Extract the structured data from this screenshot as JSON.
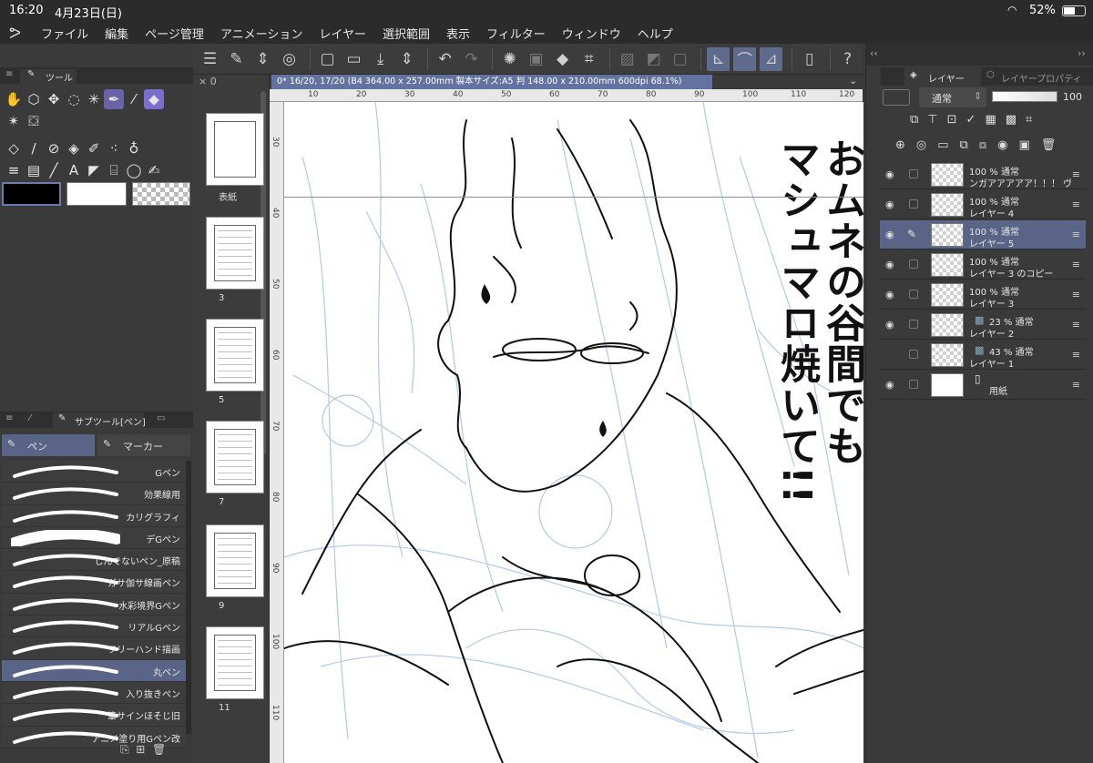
{
  "status": {
    "time": "16:20",
    "date": "4月23日(日)",
    "battery": "52%"
  },
  "menu": [
    "ファイル",
    "編集",
    "ページ管理",
    "アニメーション",
    "レイヤー",
    "選択範囲",
    "表示",
    "フィルター",
    "ウィンドウ",
    "ヘルプ"
  ],
  "tool_panel": {
    "title": "ツール"
  },
  "subtool_panel": {
    "title": "サブツール[ペン]",
    "tabs": [
      "ペン",
      "マーカー"
    ],
    "items": [
      "Gペン",
      "効果線用",
      "カリグラフィ",
      "デGペン",
      "しんでないペン_原稿",
      "ガサ伽サ線画ペン",
      "水彩境界Gペン",
      "リアルGペン",
      "フリーハンド描画",
      "丸ペン",
      "入り抜きペン",
      "筆サインほそじ旧",
      "アニメ塗り用Gペン改"
    ],
    "selected_index": 9
  },
  "pages": {
    "zoom_label": "× 0",
    "items": [
      {
        "label": "表紙"
      },
      {
        "label": "3"
      },
      {
        "label": "5"
      },
      {
        "label": "7"
      },
      {
        "label": "9"
      },
      {
        "label": "11"
      }
    ]
  },
  "canvas": {
    "tab_title": "0* 16/20, 17/20 (B4 364.00 x 257.00mm 製本サイズ:A5 判 148.00 x 210.00mm 600dpi 68.1%)",
    "ruler_top": [
      "10",
      "20",
      "30",
      "40",
      "50",
      "60",
      "70",
      "80",
      "90",
      "100",
      "110",
      "120"
    ],
    "ruler_left": [
      "30",
      "40",
      "50",
      "60",
      "70",
      "80",
      "90",
      "100",
      "110"
    ],
    "manga_text_col1": "おムネの谷間でも",
    "manga_text_col2": "マシュマロ焼いて!!"
  },
  "layers_panel": {
    "tabs": [
      "レイヤー",
      "レイヤープロパティ"
    ],
    "blend_mode": "通常",
    "opacity": "100",
    "layers": [
      {
        "line1": "100 % 通常",
        "line2": "ンガアアアアア！！！ ヴァン",
        "visible": true,
        "selected": false
      },
      {
        "line1": "100 % 通常",
        "line2": "レイヤー 4",
        "visible": true,
        "selected": false
      },
      {
        "line1": "100 % 通常",
        "line2": "レイヤー 5",
        "visible": true,
        "selected": true
      },
      {
        "line1": "100 % 通常",
        "line2": "レイヤー 3 のコピー",
        "visible": true,
        "selected": false
      },
      {
        "line1": "100 % 通常",
        "line2": "レイヤー 3",
        "visible": true,
        "selected": false
      },
      {
        "line1": "23 % 通常",
        "line2": "レイヤー 2",
        "visible": true,
        "selected": false
      },
      {
        "line1": "43 % 通常",
        "line2": "レイヤー 1",
        "visible": false,
        "selected": false
      },
      {
        "line1": "",
        "line2": "用紙",
        "visible": true,
        "selected": false
      }
    ]
  },
  "colors": {
    "accent": "#5a6486",
    "tool_selected": "#6a63a8",
    "sketch_blue": "#a9c4e8"
  }
}
